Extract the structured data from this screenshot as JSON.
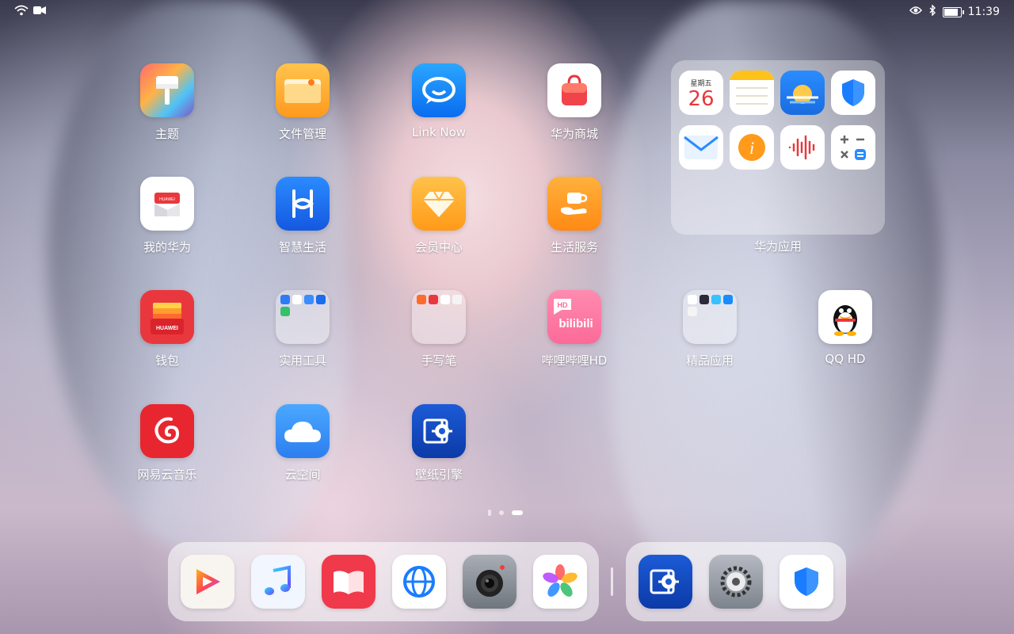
{
  "status": {
    "time": "11:39"
  },
  "apps": [
    {
      "label": "主题"
    },
    {
      "label": "文件管理"
    },
    {
      "label": "Link Now"
    },
    {
      "label": "华为商城"
    },
    {
      "label": "我的华为"
    },
    {
      "label": "智慧生活"
    },
    {
      "label": "会员中心"
    },
    {
      "label": "生活服务"
    },
    {
      "label": "钱包"
    },
    {
      "label": "实用工具"
    },
    {
      "label": "手写笔"
    },
    {
      "label": "哔哩哔哩HD"
    },
    {
      "label": "精品应用"
    },
    {
      "label": "QQ HD"
    },
    {
      "label": "网易云音乐"
    },
    {
      "label": "云空间"
    },
    {
      "label": "壁纸引擎"
    }
  ],
  "icon_text": {
    "huawei_brand": "HUAWEI",
    "bilibili_brand": "bilibili",
    "bilibili_badge": "HD"
  },
  "widget": {
    "label": "华为应用",
    "calendar_weekday": "星期五",
    "calendar_day": "26"
  },
  "pages": {
    "count": 3,
    "active": 3
  },
  "colors": {
    "accent_blue": "#1a7cff",
    "red": "#f23d3d"
  }
}
